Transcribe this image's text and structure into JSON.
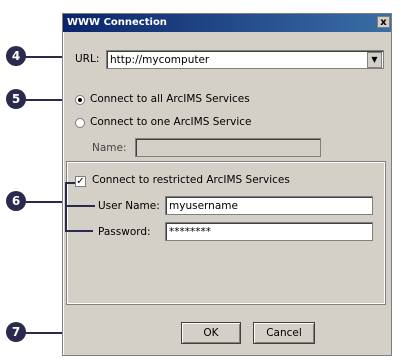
{
  "dialog": {
    "title": "WWW Connection",
    "close_glyph": "x"
  },
  "url": {
    "label": "URL:",
    "value": "http://mycomputer",
    "dropdown_glyph": "▼"
  },
  "options": {
    "all_services_label": "Connect to all ArcIMS Services",
    "one_service_label": "Connect to one ArcIMS Service",
    "name_label": "Name:",
    "name_value": ""
  },
  "restricted": {
    "label": "Connect to restricted ArcIMS Services",
    "checked_glyph": "✓",
    "username_label": "User Name:",
    "username_value": "myusername",
    "password_label": "Password:",
    "password_value": "********"
  },
  "buttons": {
    "ok_label": "OK",
    "cancel_label": "Cancel"
  },
  "callouts": {
    "c4": "4",
    "c5": "5",
    "c6": "6",
    "c7": "7"
  }
}
